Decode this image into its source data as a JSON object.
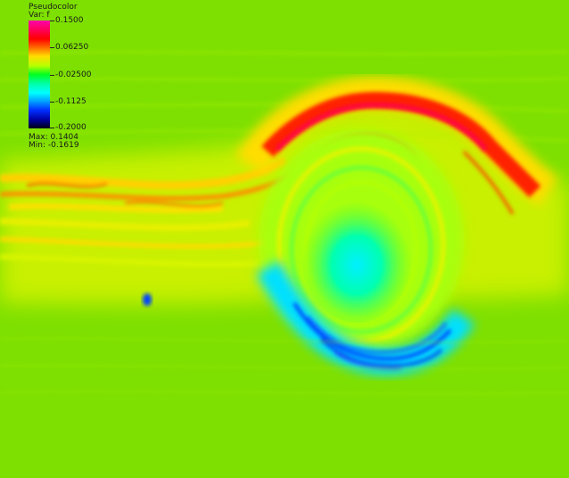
{
  "legend": {
    "title": "Pseudocolor",
    "variable": "Var: f",
    "ticks": [
      "0.1500",
      "0.06250",
      "-0.02500",
      "-0.1125",
      "-0.2000"
    ],
    "max_label": "Max:  0.1404",
    "min_label": "Min: -0.1619"
  },
  "colors": {
    "background": "#7ee000",
    "high": "#ff0000",
    "low": "#0030ff"
  }
}
